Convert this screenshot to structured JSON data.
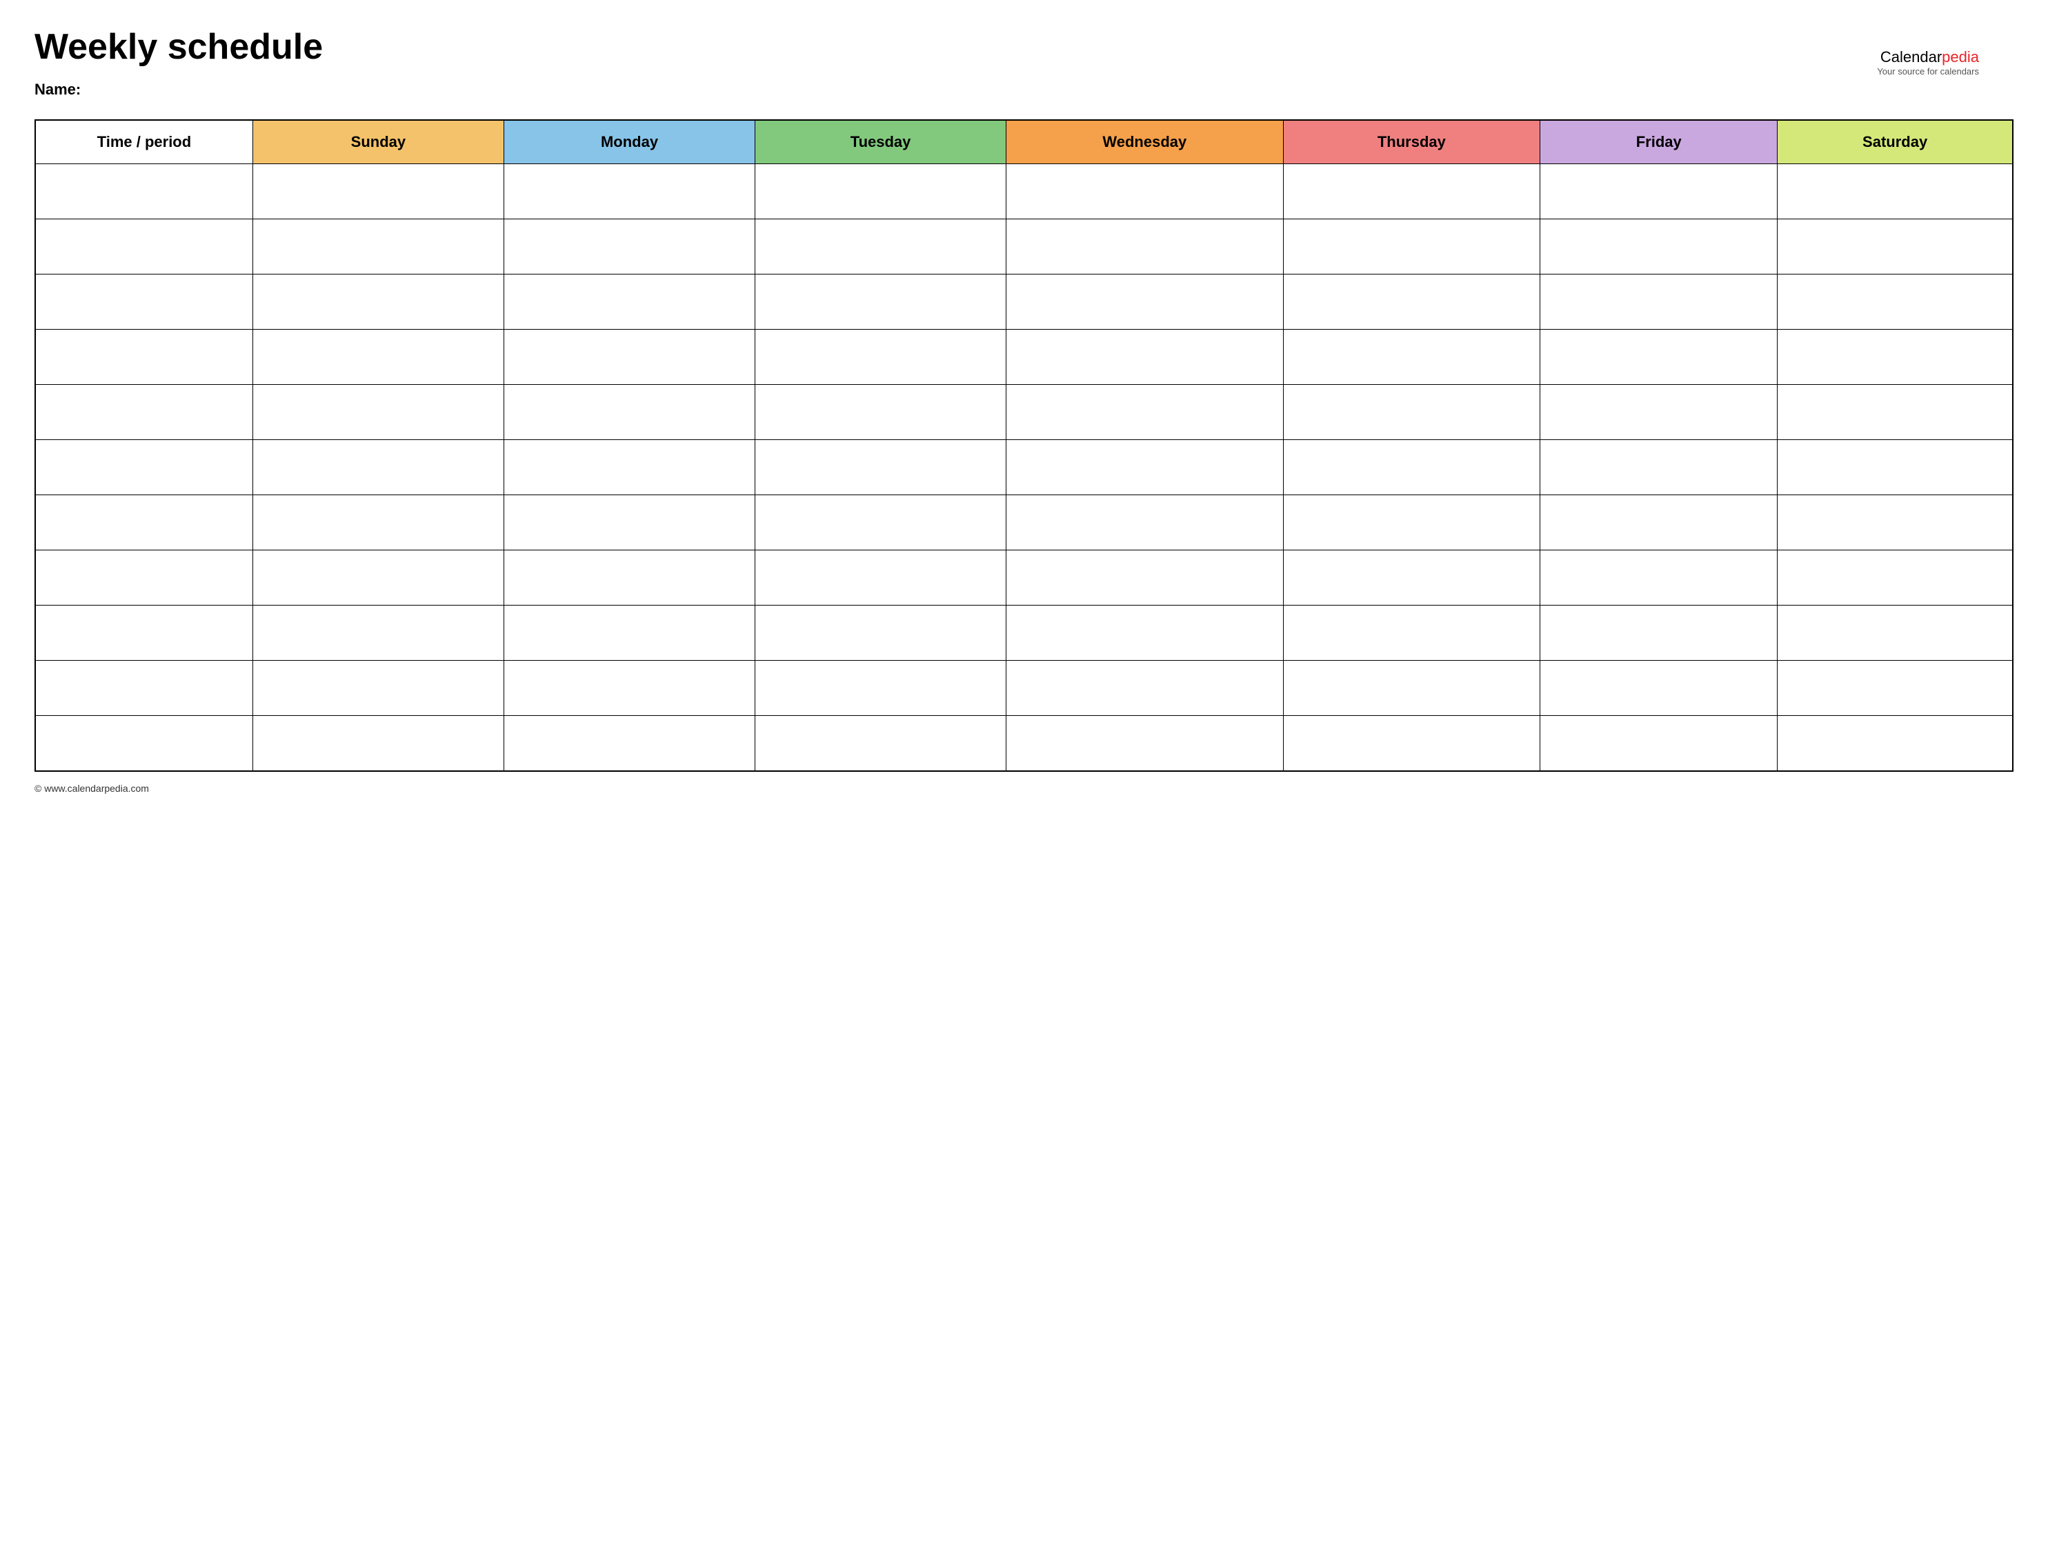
{
  "page": {
    "title": "Weekly schedule",
    "name_label": "Name:",
    "footer_text": "© www.calendarpedia.com"
  },
  "logo": {
    "brand_black": "Calendar",
    "brand_red": "pedia",
    "subtitle": "Your source for calendars"
  },
  "table": {
    "headers": [
      {
        "id": "time",
        "label": "Time / period",
        "color": "#ffffff"
      },
      {
        "id": "sunday",
        "label": "Sunday",
        "color": "#f4c26b"
      },
      {
        "id": "monday",
        "label": "Monday",
        "color": "#87c4e8"
      },
      {
        "id": "tuesday",
        "label": "Tuesday",
        "color": "#82c97e"
      },
      {
        "id": "wednesday",
        "label": "Wednesday",
        "color": "#f5a04a"
      },
      {
        "id": "thursday",
        "label": "Thursday",
        "color": "#f08080"
      },
      {
        "id": "friday",
        "label": "Friday",
        "color": "#c9a8e0"
      },
      {
        "id": "saturday",
        "label": "Saturday",
        "color": "#d4e87a"
      }
    ],
    "row_count": 11
  }
}
